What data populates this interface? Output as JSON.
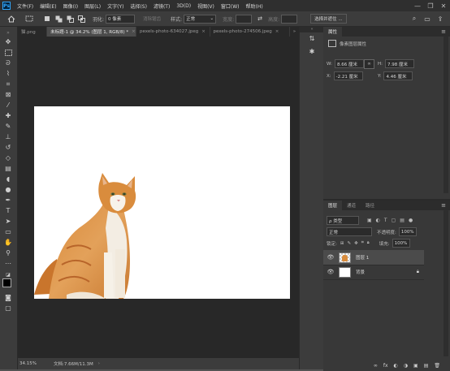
{
  "menubar": {
    "logo": "Ps",
    "items": [
      "文件(F)",
      "编辑(E)",
      "图像(I)",
      "图层(L)",
      "文字(Y)",
      "选择(S)",
      "滤镜(T)",
      "3D(D)",
      "视图(V)",
      "窗口(W)",
      "帮助(H)"
    ],
    "minimize": "—",
    "maximize": "❐",
    "close": "✕"
  },
  "options": {
    "feather_label": "羽化:",
    "feather_value": "0 像素",
    "antialias": "消除锯齿",
    "style_label": "样式:",
    "style_value": "正常",
    "width_label": "宽度:",
    "height_label": "高度:",
    "select_mask": "选择并遮住 ...",
    "search_icon": "⌕",
    "workspace_icon": "▭",
    "share_icon": "⇪"
  },
  "tabs": [
    {
      "label": "猫.png",
      "active": false
    },
    {
      "label": "未标题-1 @ 34.2% (图层 1, RGB/8) *",
      "active": true
    },
    {
      "label": "pexels-photo-634027.jpeg",
      "active": false
    },
    {
      "label": "pexels-photo-274506.jpeg",
      "active": false
    }
  ],
  "tab_close": "×",
  "tab_overflow": "»",
  "status": {
    "zoom": "34.15%",
    "doc": "文档:7.66M/11.3M",
    "arrow": "›"
  },
  "properties": {
    "tab_label": "属性",
    "section_title": "像素图层属性",
    "w_label": "W:",
    "w_value": "8.66 厘米",
    "link_icon": "∞",
    "h_label": "H:",
    "h_value": "7.98 厘米",
    "x_label": "X:",
    "x_value": "-2.21 厘米",
    "y_label": "Y:",
    "y_value": "4.46 厘米"
  },
  "layers": {
    "tabs": [
      "图层",
      "通道",
      "路径"
    ],
    "filter_label": "ρ 类型",
    "blend_mode": "正常",
    "opacity_label": "不透明度:",
    "opacity_value": "100%",
    "lock_label": "锁定:",
    "fill_label": "填充:",
    "fill_value": "100%",
    "items": [
      {
        "name": "图层 1",
        "selected": true,
        "locked": false
      },
      {
        "name": "背景",
        "selected": false,
        "locked": true
      }
    ],
    "footer_icons": [
      "∞",
      "fx",
      "◐",
      "◑",
      "▣",
      "▤",
      "🗑"
    ]
  },
  "colors": {
    "accent": "#31a8ff",
    "canvas": "#ffffff",
    "workspace": "#282828",
    "panel": "#383838",
    "selected_layer": "#4b4b4b"
  }
}
